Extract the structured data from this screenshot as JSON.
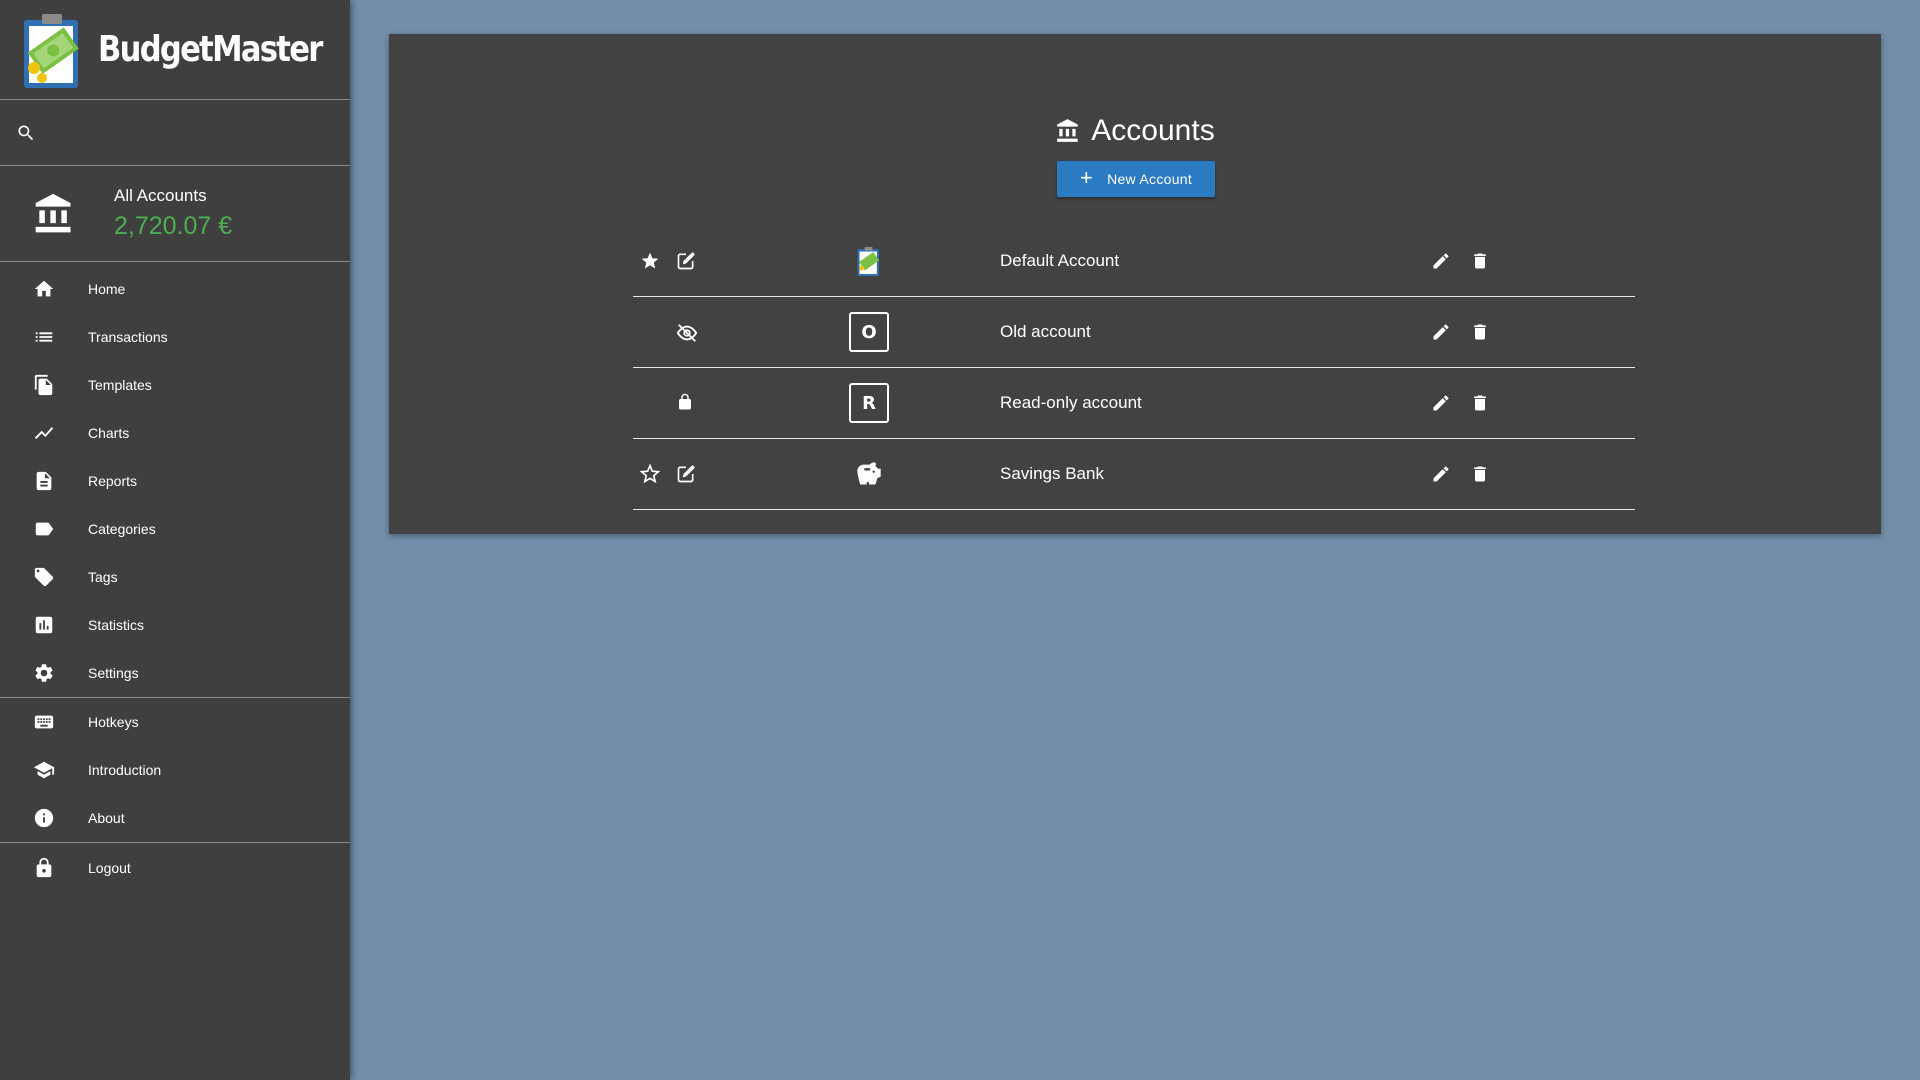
{
  "app": {
    "brand_name": "BudgetMaster"
  },
  "search": {
    "placeholder": ""
  },
  "account_summary": {
    "name": "All Accounts",
    "balance": "2,720.07 €",
    "balance_color": "#4caf50"
  },
  "nav": {
    "main": [
      {
        "label": "Home",
        "icon": "home-icon"
      },
      {
        "label": "Transactions",
        "icon": "list-icon"
      },
      {
        "label": "Templates",
        "icon": "file-copy-icon"
      },
      {
        "label": "Charts",
        "icon": "line-chart-icon"
      },
      {
        "label": "Reports",
        "icon": "document-icon"
      },
      {
        "label": "Categories",
        "icon": "label-icon"
      },
      {
        "label": "Tags",
        "icon": "tag-icon"
      },
      {
        "label": "Statistics",
        "icon": "bar-chart-icon"
      },
      {
        "label": "Settings",
        "icon": "gear-icon"
      }
    ],
    "secondary": [
      {
        "label": "Hotkeys",
        "icon": "keyboard-icon"
      },
      {
        "label": "Introduction",
        "icon": "graduation-cap-icon"
      },
      {
        "label": "About",
        "icon": "info-icon"
      }
    ],
    "logout": {
      "label": "Logout",
      "icon": "lock-icon"
    }
  },
  "main": {
    "title": "Accounts",
    "new_button_label": "New Account",
    "accent_color": "#2a7bc1",
    "accounts": [
      {
        "name": "Default Account",
        "state": "editable",
        "favorite": true,
        "icon": "budgetmaster-logo-icon"
      },
      {
        "name": "Old account",
        "state": "hidden",
        "favorite": false,
        "icon_letter": "O"
      },
      {
        "name": "Read-only account",
        "state": "read-only",
        "favorite": false,
        "icon_letter": "R"
      },
      {
        "name": "Savings Bank",
        "state": "editable",
        "favorite": false,
        "icon": "piggy-bank-icon"
      }
    ]
  }
}
